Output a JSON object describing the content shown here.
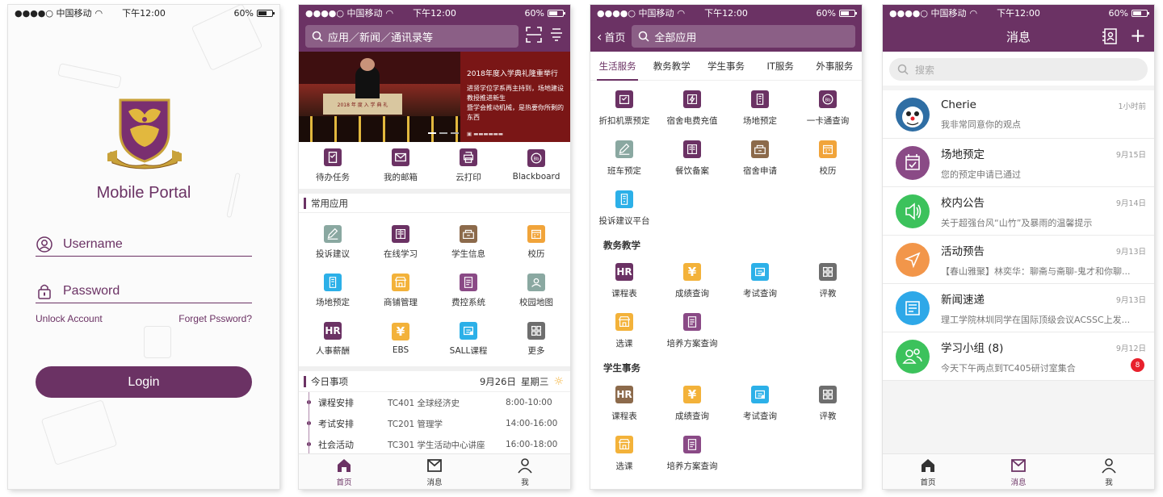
{
  "colors": {
    "brand": "#6b3264",
    "accent_gold": "#e8a916",
    "badge_red": "#e8212c"
  },
  "status_bar": {
    "carrier": "●●●●○ 中国移动",
    "time": "下午12:00",
    "battery": "60%"
  },
  "login": {
    "title": "Mobile Portal",
    "username_placeholder": "Username",
    "password_placeholder": "Password",
    "unlock_label": "Unlock Account",
    "forget_label": "Forget Pssword?",
    "login_label": "Login"
  },
  "home": {
    "search_placeholder": "应用／新闻／通讯录等",
    "banner": {
      "headline": "2018年度入学典礼隆重举行",
      "podium_text": "2018 年 度 入 学 典 礼",
      "line1": "进贤学位学系再主持到，场地建设教授推进新生",
      "line2": "暨学会推动机械，是热要你所剩的东西"
    },
    "quick_items": [
      {
        "label": "待办任务",
        "icon": "todo-icon",
        "color": "#6b3264"
      },
      {
        "label": "我的邮箱",
        "icon": "mail-icon",
        "color": "#6b3264"
      },
      {
        "label": "云打印",
        "icon": "print-icon",
        "color": "#6b3264"
      },
      {
        "label": "Blackboard",
        "icon": "bb-icon",
        "color": "#6b3264"
      }
    ],
    "common_title": "常用应用",
    "common_apps": [
      {
        "label": "投诉建议",
        "icon": "feedback-icon",
        "color": "#8aa8a1"
      },
      {
        "label": "在线学习",
        "icon": "book-icon",
        "color": "#6b3264"
      },
      {
        "label": "学生信息",
        "icon": "student-icon",
        "color": "#8c6a4b"
      },
      {
        "label": "校历",
        "icon": "calendar-icon",
        "color": "#f1a43a"
      },
      {
        "label": "场地预定",
        "icon": "venue-icon",
        "color": "#2cb0e8"
      },
      {
        "label": "商铺管理",
        "icon": "shop-icon",
        "color": "#f3b23a"
      },
      {
        "label": "费控系统",
        "icon": "fee-icon",
        "color": "#8a4a86"
      },
      {
        "label": "校园地图",
        "icon": "map-icon",
        "color": "#8aa8a1"
      },
      {
        "label": "人事薪酬",
        "icon": "hr-icon",
        "color": "#6b3264",
        "glyph": "HR"
      },
      {
        "label": "EBS",
        "icon": "yen-icon",
        "color": "#f3b23a",
        "glyph": "¥"
      },
      {
        "label": "SALL课程",
        "icon": "sall-icon",
        "color": "#2cb0e8"
      },
      {
        "label": "更多",
        "icon": "more-icon",
        "color": "#6e6e6e"
      }
    ],
    "today_title": "今日事项",
    "today_date": "9月26日",
    "today_weekday": "星期三",
    "schedule": [
      {
        "title": "课程安排",
        "detail": "TC401 全球经济史",
        "time": "8:00-10:00"
      },
      {
        "title": "考试安排",
        "detail": "TC201 管理学",
        "time": "14:00-16:00"
      },
      {
        "title": "社会活动",
        "detail": "TC301 学生活动中心讲座",
        "time": "16:00-18:00"
      }
    ],
    "tabs": [
      {
        "label": "首页",
        "icon": "home-icon",
        "active": true
      },
      {
        "label": "消息",
        "icon": "message-icon",
        "active": false
      },
      {
        "label": "我",
        "icon": "profile-icon",
        "active": false
      }
    ]
  },
  "apps": {
    "back_label": "首页",
    "search_placeholder": "全部应用",
    "categories": [
      "生活服务",
      "教务教学",
      "学生事务",
      "IT服务",
      "外事服务"
    ],
    "life": [
      {
        "label": "折扣机票预定",
        "icon": "ticket-icon",
        "color": "#6b3264"
      },
      {
        "label": "宿舍电费充值",
        "icon": "electric-icon",
        "color": "#6b3264"
      },
      {
        "label": "场地预定",
        "icon": "venue-icon",
        "color": "#6b3264"
      },
      {
        "label": "一卡通查询",
        "icon": "card-icon",
        "color": "#6b3264"
      },
      {
        "label": "班车预定",
        "icon": "bus-icon",
        "color": "#8aa8a1"
      },
      {
        "label": "餐饮备案",
        "icon": "dining-icon",
        "color": "#6b3264"
      },
      {
        "label": "宿舍申请",
        "icon": "dorm-icon",
        "color": "#8c6a4b"
      },
      {
        "label": "校历",
        "icon": "calendar-icon",
        "color": "#f1a43a"
      },
      {
        "label": "投诉建议平台",
        "icon": "complaint-icon",
        "color": "#2cb0e8"
      }
    ],
    "academic_title": "教务教学",
    "academic": [
      {
        "label": "课程表",
        "icon": "hr-icon",
        "color": "#6b3264",
        "glyph": "HR"
      },
      {
        "label": "成绩查询",
        "icon": "yen-icon",
        "color": "#f3b23a",
        "glyph": "¥"
      },
      {
        "label": "考试查询",
        "icon": "exam-icon",
        "color": "#2cb0e8"
      },
      {
        "label": "评教",
        "icon": "grid-icon",
        "color": "#6e6e6e"
      },
      {
        "label": "选课",
        "icon": "select-icon",
        "color": "#f3b23a"
      },
      {
        "label": "培养方案查询",
        "icon": "plan-icon",
        "color": "#8a4a86"
      }
    ],
    "student_title": "学生事务",
    "student": [
      {
        "label": "课程表",
        "icon": "hr-icon",
        "color": "#8c6a4b",
        "glyph": "HR"
      },
      {
        "label": "成绩查询",
        "icon": "yen-icon",
        "color": "#f3b23a",
        "glyph": "¥"
      },
      {
        "label": "考试查询",
        "icon": "exam-icon",
        "color": "#2cb0e8"
      },
      {
        "label": "评教",
        "icon": "grid-icon",
        "color": "#6e6e6e"
      },
      {
        "label": "选课",
        "icon": "select-icon",
        "color": "#f3b23a"
      },
      {
        "label": "培养方案查询",
        "icon": "plan-icon",
        "color": "#8a4a86"
      }
    ]
  },
  "messages": {
    "title": "消息",
    "search_placeholder": "搜索",
    "items": [
      {
        "name": "Cherie",
        "preview": "我非常同意你的观点",
        "time": "1小时前",
        "avatar": "cherie-avatar",
        "color": "#2f6ea4"
      },
      {
        "name": "场地预定",
        "preview": "您的预定申请已通过",
        "time": "9月15日",
        "avatar": "calendar-check-icon",
        "color": "#8a4a86"
      },
      {
        "name": "校内公告",
        "preview": "关于超强台风“山竹”及暴雨的温馨提示",
        "time": "9月14日",
        "avatar": "speaker-icon",
        "color": "#3cc25c"
      },
      {
        "name": "活动预告",
        "preview": "【春山雅聚】林奕华：聊斋与斋聊-鬼才和你聊...",
        "time": "9月13日",
        "avatar": "location-icon",
        "color": "#f2964a"
      },
      {
        "name": "新闻速递",
        "preview": "理工学院林圳同学在国际顶级会议ACSSC上发...",
        "time": "9月13日",
        "avatar": "news-icon",
        "color": "#2ea8e8"
      },
      {
        "name": "学习小组 (8)",
        "preview": "今天下午两点到TC405研讨室集合",
        "time": "9月12日",
        "avatar": "group-icon",
        "color": "#3cc25c",
        "badge": "8"
      }
    ],
    "tabs": [
      {
        "label": "首页",
        "icon": "home-icon",
        "active": false
      },
      {
        "label": "消息",
        "icon": "message-icon",
        "active": true
      },
      {
        "label": "我",
        "icon": "profile-icon",
        "active": false
      }
    ]
  }
}
